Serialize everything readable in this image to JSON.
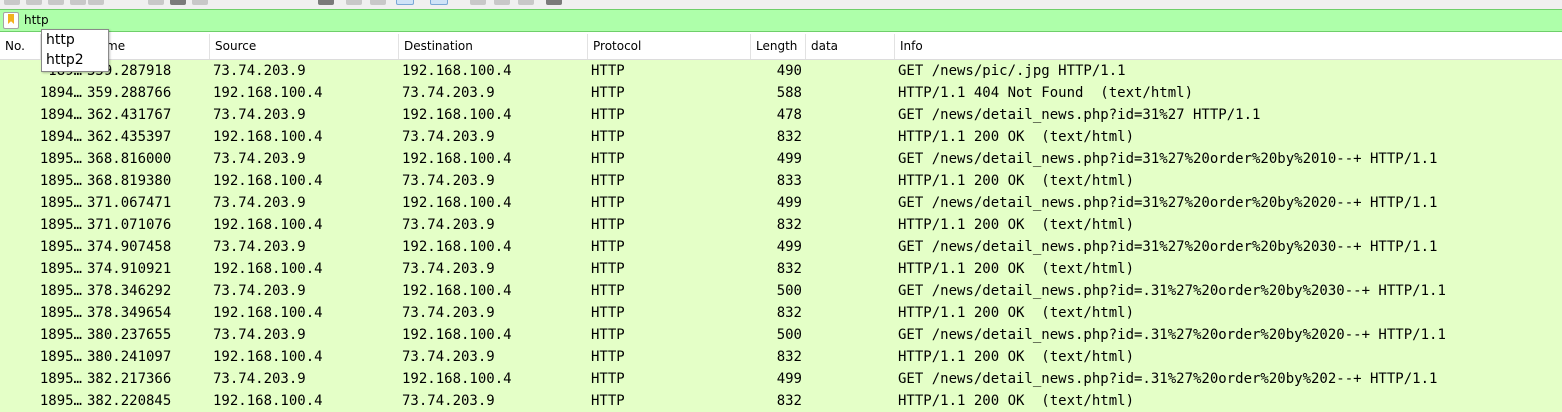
{
  "filter": {
    "value": "http",
    "autocomplete": [
      "http",
      "http2"
    ]
  },
  "columns": {
    "no": "No.",
    "time": "Time",
    "source": "Source",
    "destination": "Destination",
    "protocol": "Protocol",
    "length": "Length",
    "data": "data",
    "info": "Info"
  },
  "header_time_visible": "me",
  "colors": {
    "filter_bg": "#aeffaa",
    "row_bg": "#e4ffc7"
  },
  "packets": [
    {
      "no": "189…",
      "time": "359.287918",
      "src": "73.74.203.9",
      "dst": "192.168.100.4",
      "proto": "HTTP",
      "len": "490",
      "info": "GET /news/pic/.jpg HTTP/1.1"
    },
    {
      "no": "1894…",
      "time": "359.288766",
      "src": "192.168.100.4",
      "dst": "73.74.203.9",
      "proto": "HTTP",
      "len": "588",
      "info": "HTTP/1.1 404 Not Found  (text/html)"
    },
    {
      "no": "1894…",
      "time": "362.431767",
      "src": "73.74.203.9",
      "dst": "192.168.100.4",
      "proto": "HTTP",
      "len": "478",
      "info": "GET /news/detail_news.php?id=31%27 HTTP/1.1"
    },
    {
      "no": "1894…",
      "time": "362.435397",
      "src": "192.168.100.4",
      "dst": "73.74.203.9",
      "proto": "HTTP",
      "len": "832",
      "info": "HTTP/1.1 200 OK  (text/html)"
    },
    {
      "no": "1895…",
      "time": "368.816000",
      "src": "73.74.203.9",
      "dst": "192.168.100.4",
      "proto": "HTTP",
      "len": "499",
      "info": "GET /news/detail_news.php?id=31%27%20order%20by%2010--+ HTTP/1.1"
    },
    {
      "no": "1895…",
      "time": "368.819380",
      "src": "192.168.100.4",
      "dst": "73.74.203.9",
      "proto": "HTTP",
      "len": "833",
      "info": "HTTP/1.1 200 OK  (text/html)"
    },
    {
      "no": "1895…",
      "time": "371.067471",
      "src": "73.74.203.9",
      "dst": "192.168.100.4",
      "proto": "HTTP",
      "len": "499",
      "info": "GET /news/detail_news.php?id=31%27%20order%20by%2020--+ HTTP/1.1"
    },
    {
      "no": "1895…",
      "time": "371.071076",
      "src": "192.168.100.4",
      "dst": "73.74.203.9",
      "proto": "HTTP",
      "len": "832",
      "info": "HTTP/1.1 200 OK  (text/html)"
    },
    {
      "no": "1895…",
      "time": "374.907458",
      "src": "73.74.203.9",
      "dst": "192.168.100.4",
      "proto": "HTTP",
      "len": "499",
      "info": "GET /news/detail_news.php?id=31%27%20order%20by%2030--+ HTTP/1.1"
    },
    {
      "no": "1895…",
      "time": "374.910921",
      "src": "192.168.100.4",
      "dst": "73.74.203.9",
      "proto": "HTTP",
      "len": "832",
      "info": "HTTP/1.1 200 OK  (text/html)"
    },
    {
      "no": "1895…",
      "time": "378.346292",
      "src": "73.74.203.9",
      "dst": "192.168.100.4",
      "proto": "HTTP",
      "len": "500",
      "info": "GET /news/detail_news.php?id=.31%27%20order%20by%2030--+ HTTP/1.1"
    },
    {
      "no": "1895…",
      "time": "378.349654",
      "src": "192.168.100.4",
      "dst": "73.74.203.9",
      "proto": "HTTP",
      "len": "832",
      "info": "HTTP/1.1 200 OK  (text/html)"
    },
    {
      "no": "1895…",
      "time": "380.237655",
      "src": "73.74.203.9",
      "dst": "192.168.100.4",
      "proto": "HTTP",
      "len": "500",
      "info": "GET /news/detail_news.php?id=.31%27%20order%20by%2020--+ HTTP/1.1"
    },
    {
      "no": "1895…",
      "time": "380.241097",
      "src": "192.168.100.4",
      "dst": "73.74.203.9",
      "proto": "HTTP",
      "len": "832",
      "info": "HTTP/1.1 200 OK  (text/html)"
    },
    {
      "no": "1895…",
      "time": "382.217366",
      "src": "73.74.203.9",
      "dst": "192.168.100.4",
      "proto": "HTTP",
      "len": "499",
      "info": "GET /news/detail_news.php?id=.31%27%20order%20by%202--+ HTTP/1.1"
    },
    {
      "no": "1895…",
      "time": "382.220845",
      "src": "192.168.100.4",
      "dst": "73.74.203.9",
      "proto": "HTTP",
      "len": "832",
      "info": "HTTP/1.1 200 OK  (text/html)"
    }
  ]
}
